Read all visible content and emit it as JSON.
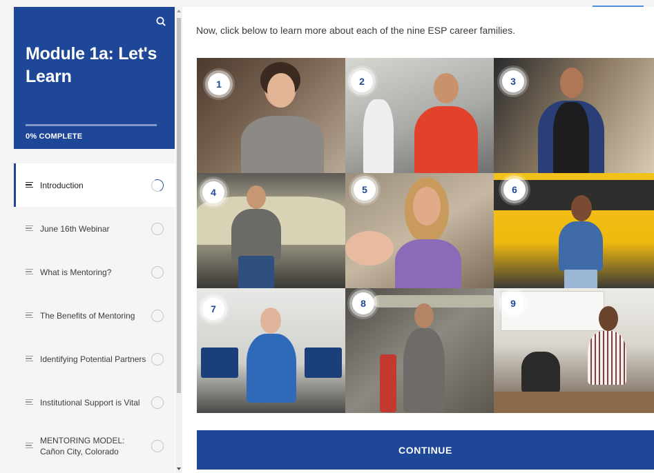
{
  "sidebar": {
    "title": "Module 1a: Let's Learn",
    "progress_percent": 0,
    "progress_label": "0% COMPLETE",
    "lessons": [
      {
        "label": "Introduction",
        "active": true
      },
      {
        "label": "June 16th Webinar",
        "active": false
      },
      {
        "label": "What is Mentoring?",
        "active": false
      },
      {
        "label": "The Benefits of Mentoring",
        "active": false
      },
      {
        "label": "Identifying Potential Partners",
        "active": false
      },
      {
        "label": "Institutional Support is Vital",
        "active": false
      },
      {
        "label": "MENTORING MODEL: Cañon City, Colorado",
        "active": false
      }
    ]
  },
  "main": {
    "intro": "Now, click below to learn more about each of the nine ESP career families.",
    "career_tiles": [
      "1",
      "2",
      "3",
      "4",
      "5",
      "6",
      "7",
      "8",
      "9"
    ],
    "continue_label": "CONTINUE"
  },
  "colors": {
    "brand_blue": "#1e4797",
    "sidebar_bg": "#f5f5f6",
    "tab_indicator": "#4a8fe0"
  },
  "icons": {
    "search": "search-icon",
    "lesson_type": "lines-icon",
    "lesson_status": "circle-progress-icon"
  }
}
